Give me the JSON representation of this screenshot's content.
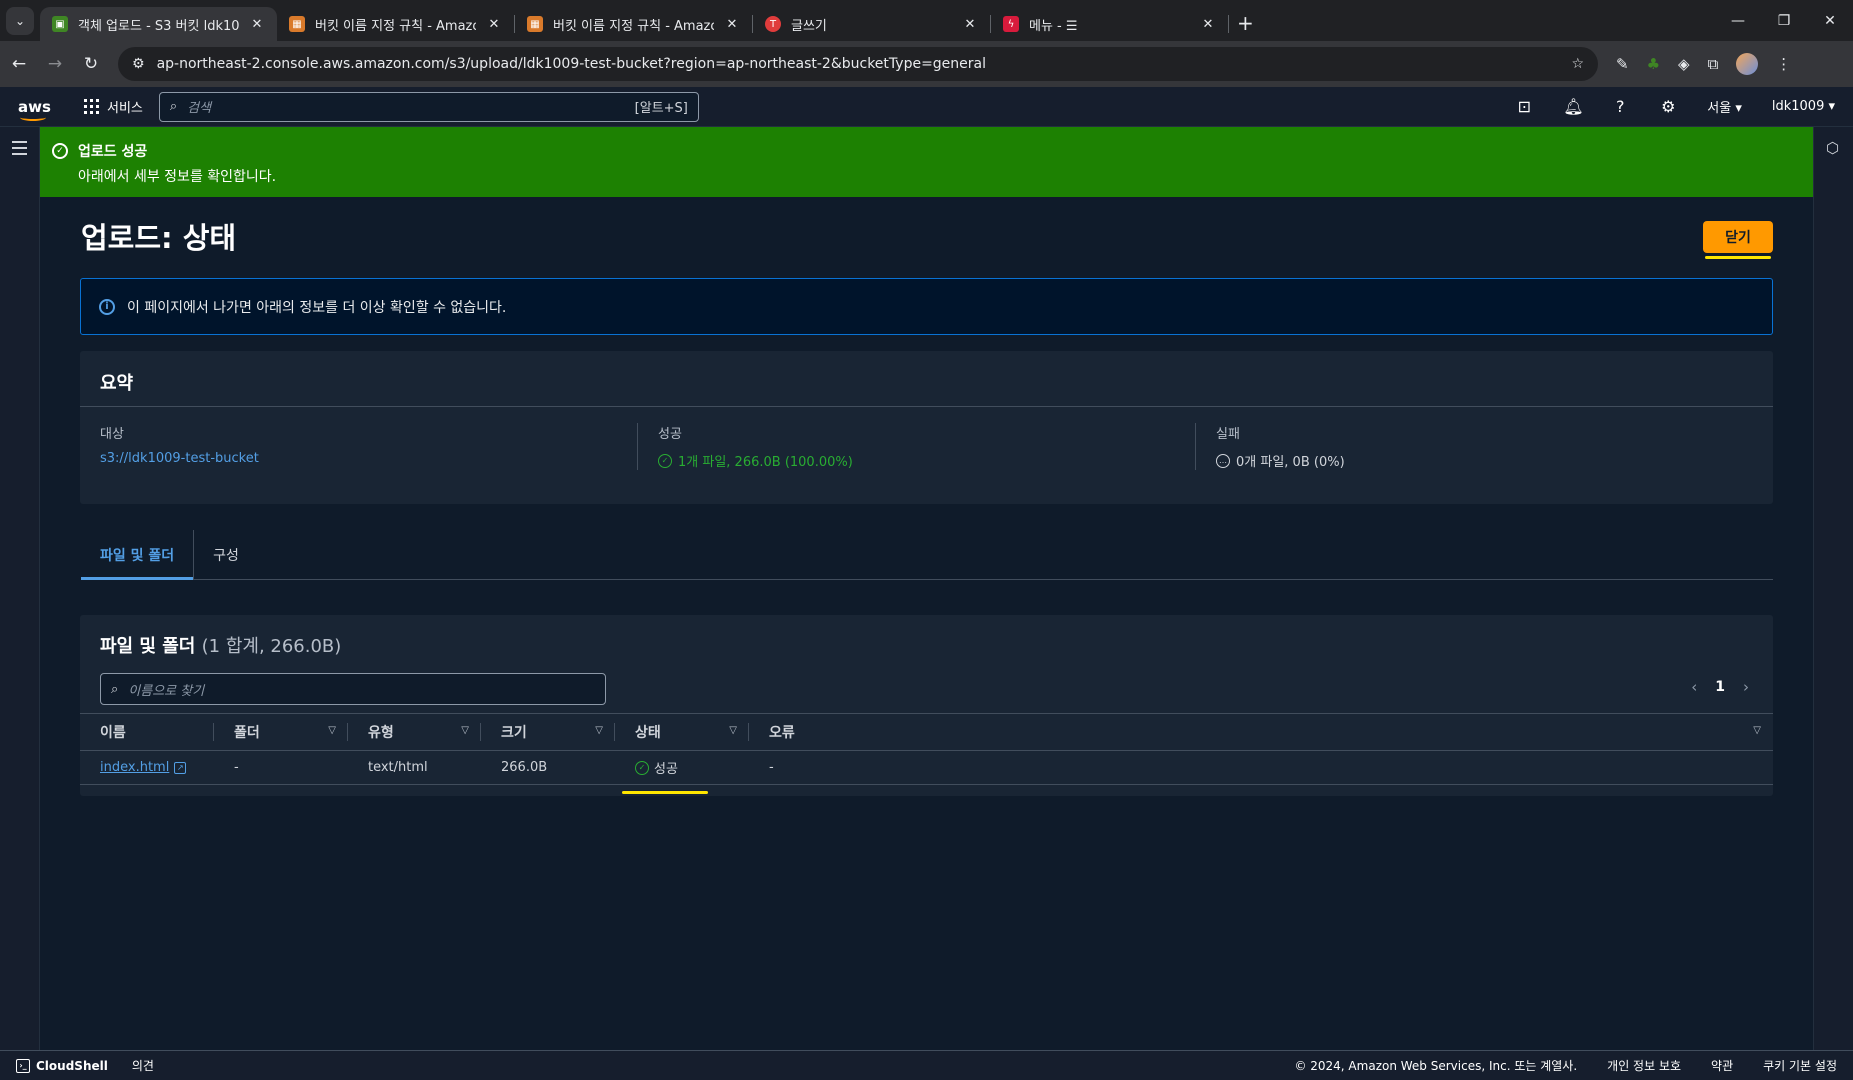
{
  "browser": {
    "tabs": [
      {
        "title": "객체 업로드 - S3 버킷 ldk1009",
        "favicon_color": "#3f8624",
        "active": true
      },
      {
        "title": "버킷 이름 지정 규칙 - Amazon",
        "favicon_color": "#d97a2b",
        "active": false
      },
      {
        "title": "버킷 이름 지정 규칙 - Amazon",
        "favicon_color": "#d97a2b",
        "active": false
      },
      {
        "title": "글쓰기",
        "favicon_color": "#e03c3c",
        "active": false
      },
      {
        "title": "메뉴 - ☰",
        "favicon_color": "#d81b3c",
        "active": false
      }
    ],
    "url": "ap-northeast-2.console.aws.amazon.com/s3/upload/ldk1009-test-bucket?region=ap-northeast-2&bucketType=general"
  },
  "awsnav": {
    "logo": "aws",
    "services_label": "서비스",
    "search_placeholder": "검색",
    "search_shortcut": "[알트+S]",
    "region": "서울 ▾",
    "account": "ldk1009 ▾"
  },
  "flash": {
    "title": "업로드 성공",
    "message": "아래에서 세부 정보를 확인합니다.",
    "color": "#1d8102"
  },
  "page": {
    "title": "업로드: 상태",
    "close_label": "닫기",
    "info_message": "이 페이지에서 나가면 아래의 정보를 더 이상 확인할 수 없습니다."
  },
  "summary": {
    "heading": "요약",
    "destination_label": "대상",
    "destination_value": "s3://ldk1009-test-bucket",
    "success_label": "성공",
    "success_value": "1개 파일, 266.0B (100.00%)",
    "failed_label": "실패",
    "failed_value": "0개 파일, 0B (0%)"
  },
  "tabs": [
    {
      "label": "파일 및 폴더",
      "active": true
    },
    {
      "label": "구성",
      "active": false
    }
  ],
  "files": {
    "heading": "파일 및 폴더",
    "count": "(1 합계, 266.0B)",
    "filter_placeholder": "이름으로 찾기",
    "page": "1",
    "columns": [
      "이름",
      "폴더",
      "유형",
      "크기",
      "상태",
      "오류"
    ],
    "rows": [
      {
        "name": "index.html",
        "folder": "-",
        "type": "text/html",
        "size": "266.0B",
        "status": "성공",
        "error": "-"
      }
    ]
  },
  "footer": {
    "cloudshell": "CloudShell",
    "feedback": "의견",
    "copyright": "© 2024, Amazon Web Services, Inc. 또는 계열사.",
    "privacy": "개인 정보 보호",
    "terms": "약관",
    "cookies": "쿠키 기본 설정"
  }
}
